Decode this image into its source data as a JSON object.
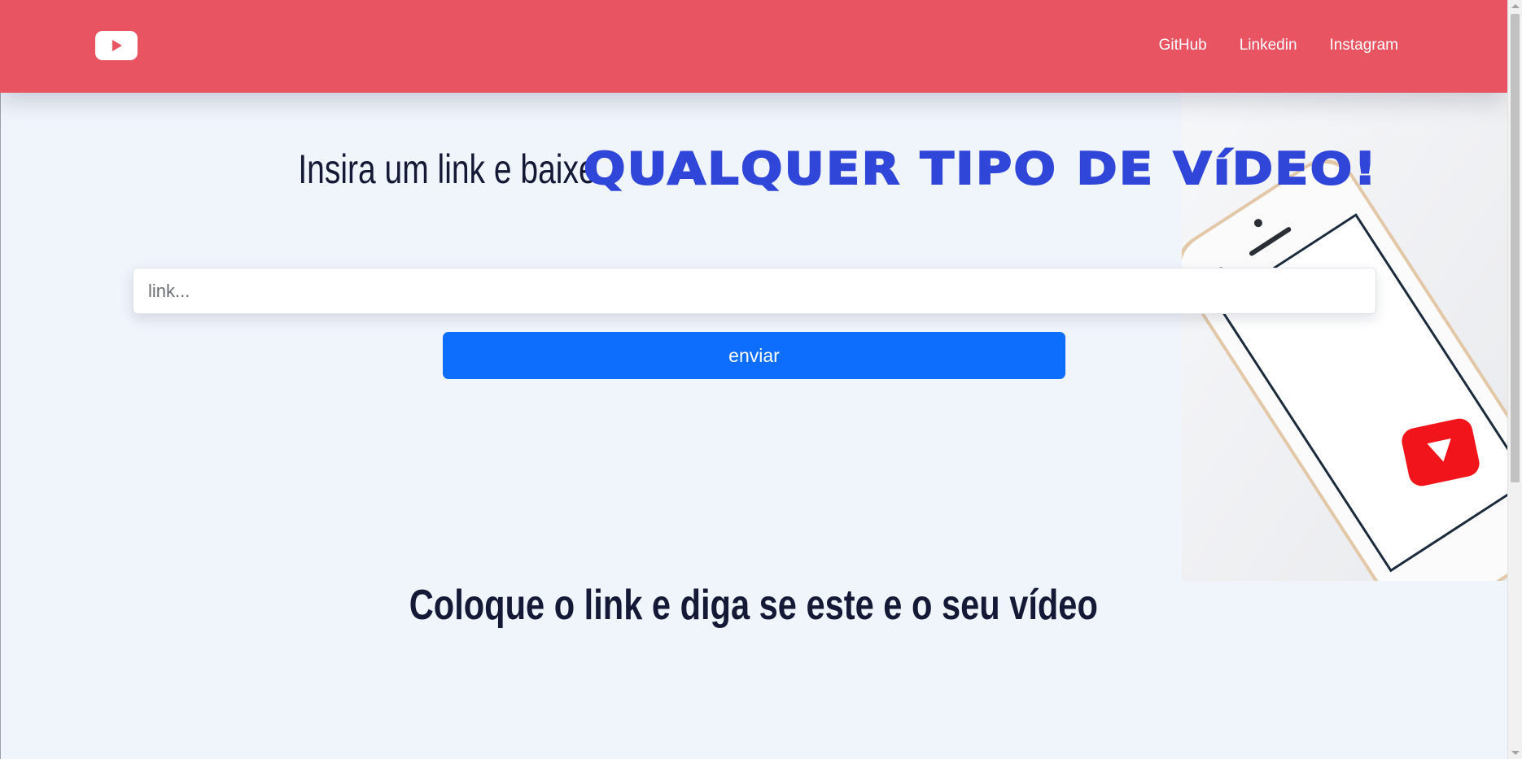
{
  "header": {
    "logo_icon": "youtube-play-icon",
    "nav": [
      {
        "label": "GitHub"
      },
      {
        "label": "Linkedin"
      },
      {
        "label": "Instagram"
      }
    ]
  },
  "hero": {
    "headline_lead": "Insira um link e baixe",
    "headline_accent": "QUALQUER TIPO DE VíDEO!",
    "image_icon": "phone-youtube-illustration"
  },
  "form": {
    "link_placeholder": "link...",
    "link_value": "",
    "submit_label": "enviar"
  },
  "section": {
    "heading": "Coloque o link e diga se este e o seu vídeo"
  },
  "colors": {
    "header_bg": "#e85462",
    "page_bg": "#f0f4fb",
    "accent_text": "#3046d8",
    "button_bg": "#0d6efd",
    "heading_text": "#141a36"
  }
}
